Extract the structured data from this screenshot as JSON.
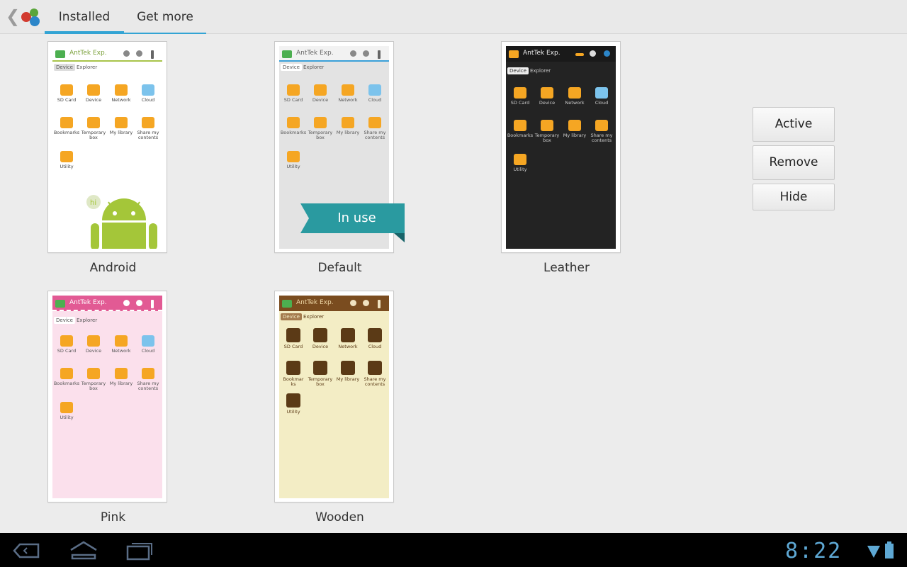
{
  "tabs": {
    "installed": "Installed",
    "get_more": "Get more"
  },
  "themes": {
    "android": {
      "label": "Android",
      "app_title": "AntTek Exp.",
      "device": "Device",
      "explorer": "Explorer",
      "hi": "hi"
    },
    "default": {
      "label": "Default",
      "app_title": "AntTek Exp.",
      "device": "Device",
      "explorer": "Explorer"
    },
    "leather": {
      "label": "Leather",
      "app_title": "AntTek Exp.",
      "device": "Device",
      "explorer": "Explorer"
    },
    "pink": {
      "label": "Pink",
      "app_title": "AntTek Exp.",
      "device": "Device",
      "explorer": "Explorer"
    },
    "wooden": {
      "label": "Wooden",
      "app_title": "AntTek Exp.",
      "device": "Device",
      "explorer": "Explorer"
    }
  },
  "grid_items": [
    "SD Card",
    "Device",
    "Network",
    "Cloud",
    "Bookmarks",
    "Temporary box",
    "My library",
    "Share my contents",
    "Utility"
  ],
  "wooden_bookmarks": "Bookmarks",
  "in_use_badge": "In use",
  "actions": {
    "active": "Active",
    "remove": "Remove",
    "hide": "Hide"
  },
  "status": {
    "time": "8:22"
  },
  "colors": {
    "accent": "#33a4d4",
    "in_use": "#2a9aa0",
    "background": "#ececec",
    "navbar": "#000000"
  },
  "icons": {
    "back": "chevron-left-icon",
    "app_logo": "app-logo-icon",
    "nav_back": "nav-back-icon",
    "nav_home": "nav-home-icon",
    "nav_recent": "nav-recent-apps-icon",
    "wifi": "wifi-signal-icon",
    "battery": "battery-icon"
  }
}
